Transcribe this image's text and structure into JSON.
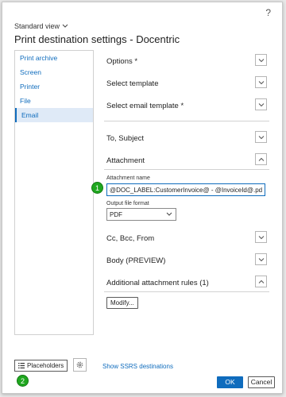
{
  "header": {
    "help_icon": "?",
    "view_label": "Standard view",
    "title": "Print destination settings - Docentric"
  },
  "nav": {
    "items": [
      {
        "label": "Print archive",
        "active": false
      },
      {
        "label": "Screen",
        "active": false
      },
      {
        "label": "Printer",
        "active": false
      },
      {
        "label": "File",
        "active": false
      },
      {
        "label": "Email",
        "active": true
      }
    ]
  },
  "sections": {
    "options": "Options *",
    "select_template": "Select template",
    "select_email_template": "Select email template *",
    "to_subject": "To, Subject",
    "attachment": "Attachment",
    "cc_bcc_from": "Cc, Bcc, From",
    "body": "Body (PREVIEW)",
    "additional_rules": "Additional attachment rules (1)"
  },
  "attachment": {
    "name_label": "Attachment name",
    "name_value": "@DOC_LABEL:CustomerInvoice@ - @InvoiceId@.pdf",
    "format_label": "Output file format",
    "format_value": "PDF"
  },
  "buttons": {
    "modify": "Modify...",
    "placeholders": "Placeholders",
    "ssrs": "Show SSRS destinations",
    "ok": "OK",
    "cancel": "Cancel"
  },
  "badges": {
    "one": "1",
    "two": "2"
  },
  "colors": {
    "accent": "#0f6cbd",
    "badge": "#1fa71f"
  }
}
